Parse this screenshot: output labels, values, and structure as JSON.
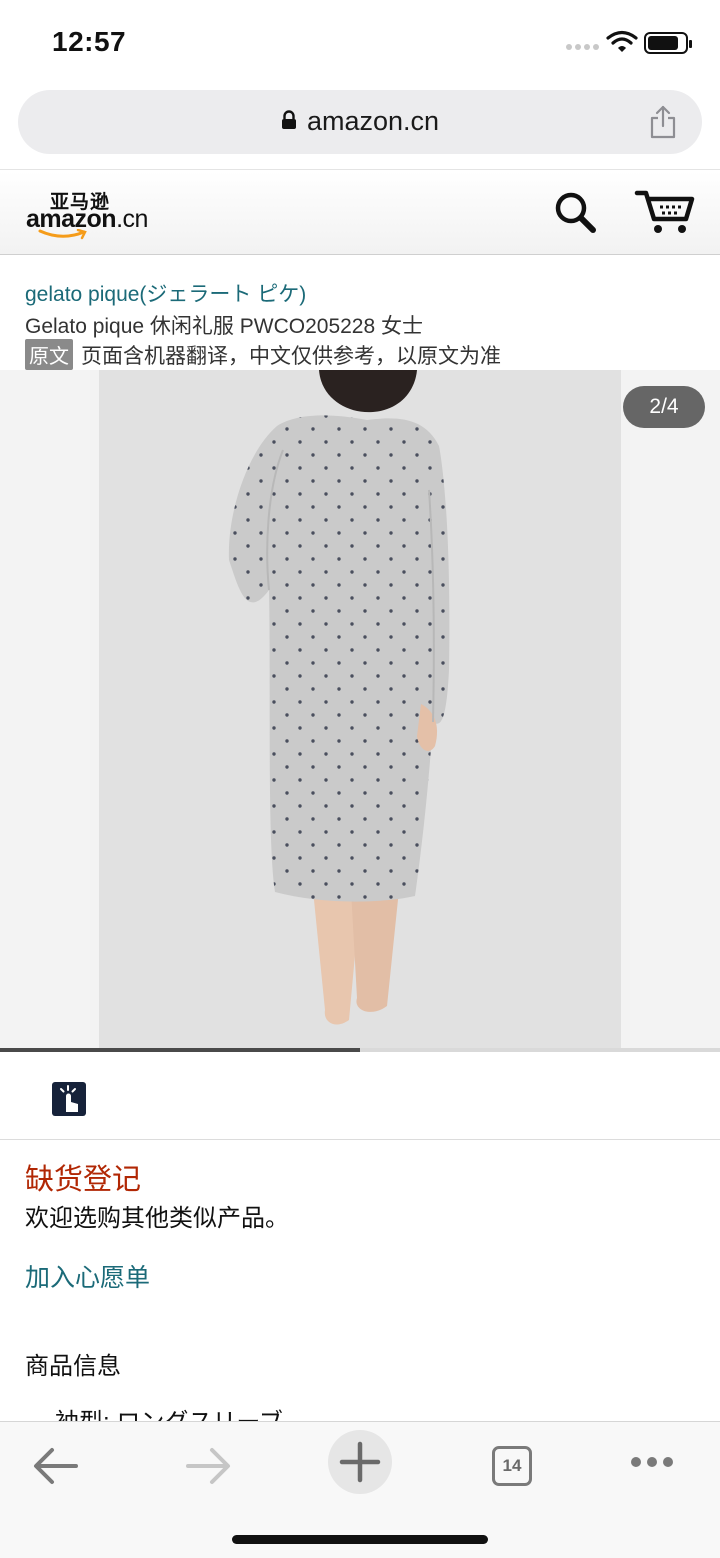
{
  "status_bar": {
    "time": "12:57"
  },
  "browser": {
    "url": "amazon.cn"
  },
  "header": {
    "logo_cn": "亚马逊",
    "logo_word": "amazon",
    "logo_suffix": ".cn",
    "icons": [
      "search-icon",
      "cart-icon"
    ]
  },
  "product": {
    "brand": "gelato pique(ジェラート ピケ)",
    "title": "Gelato pique 休闲礼服 PWCO205228 女士",
    "mt_tag": "原文",
    "mt_notice": "页面含机器翻译，中文仅供参考，以原文为准"
  },
  "gallery": {
    "counter": "2/4",
    "current": 2,
    "total": 4
  },
  "availability": {
    "status": "缺货登记",
    "message": "欢迎选购其他类似产品。"
  },
  "actions": {
    "wishlist": "加入心愿单"
  },
  "info": {
    "heading": "商品信息",
    "items": [
      "袖型: ロングスリーブ"
    ]
  },
  "toolbar": {
    "tabs_count": "14",
    "icons": [
      "back-arrow-icon",
      "forward-arrow-icon",
      "plus-icon",
      "tabs-icon",
      "more-icon"
    ]
  },
  "colors": {
    "link": "#1b6a78",
    "availability": "#b12704",
    "counter_bg": "#666666"
  }
}
